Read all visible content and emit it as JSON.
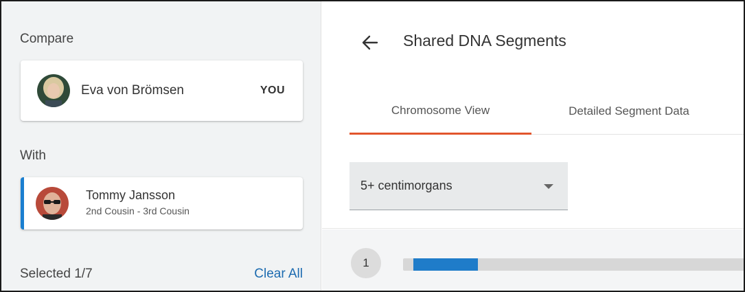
{
  "sidebar": {
    "compare_label": "Compare",
    "you_card": {
      "name": "Eva von Brömsen",
      "tag": "YOU",
      "avatar_icon": "user-photo-woman"
    },
    "with_label": "With",
    "match_card": {
      "name": "Tommy Jansson",
      "relationship": "2nd Cousin - 3rd Cousin",
      "avatar_icon": "user-photo-man-sunglasses"
    },
    "selected_text": "Selected 1/7",
    "clear_all_label": "Clear All"
  },
  "header": {
    "back_icon": "arrow-left-icon",
    "title": "Shared DNA Segments"
  },
  "tabs": [
    {
      "label": "Chromosome View",
      "active": true
    },
    {
      "label": "Detailed Segment Data",
      "active": false
    }
  ],
  "filter": {
    "selected_value": "5+ centimorgans",
    "caret_icon": "caret-down-icon"
  },
  "chromosomes": [
    {
      "number": "1",
      "segment_start_fraction": 0.03,
      "segment_end_fraction": 0.22
    }
  ],
  "colors": {
    "accent_tab": "#e2552c",
    "segment_blue": "#1f7cc9",
    "match_border": "#1a7fd0",
    "link": "#1c6bb0"
  }
}
